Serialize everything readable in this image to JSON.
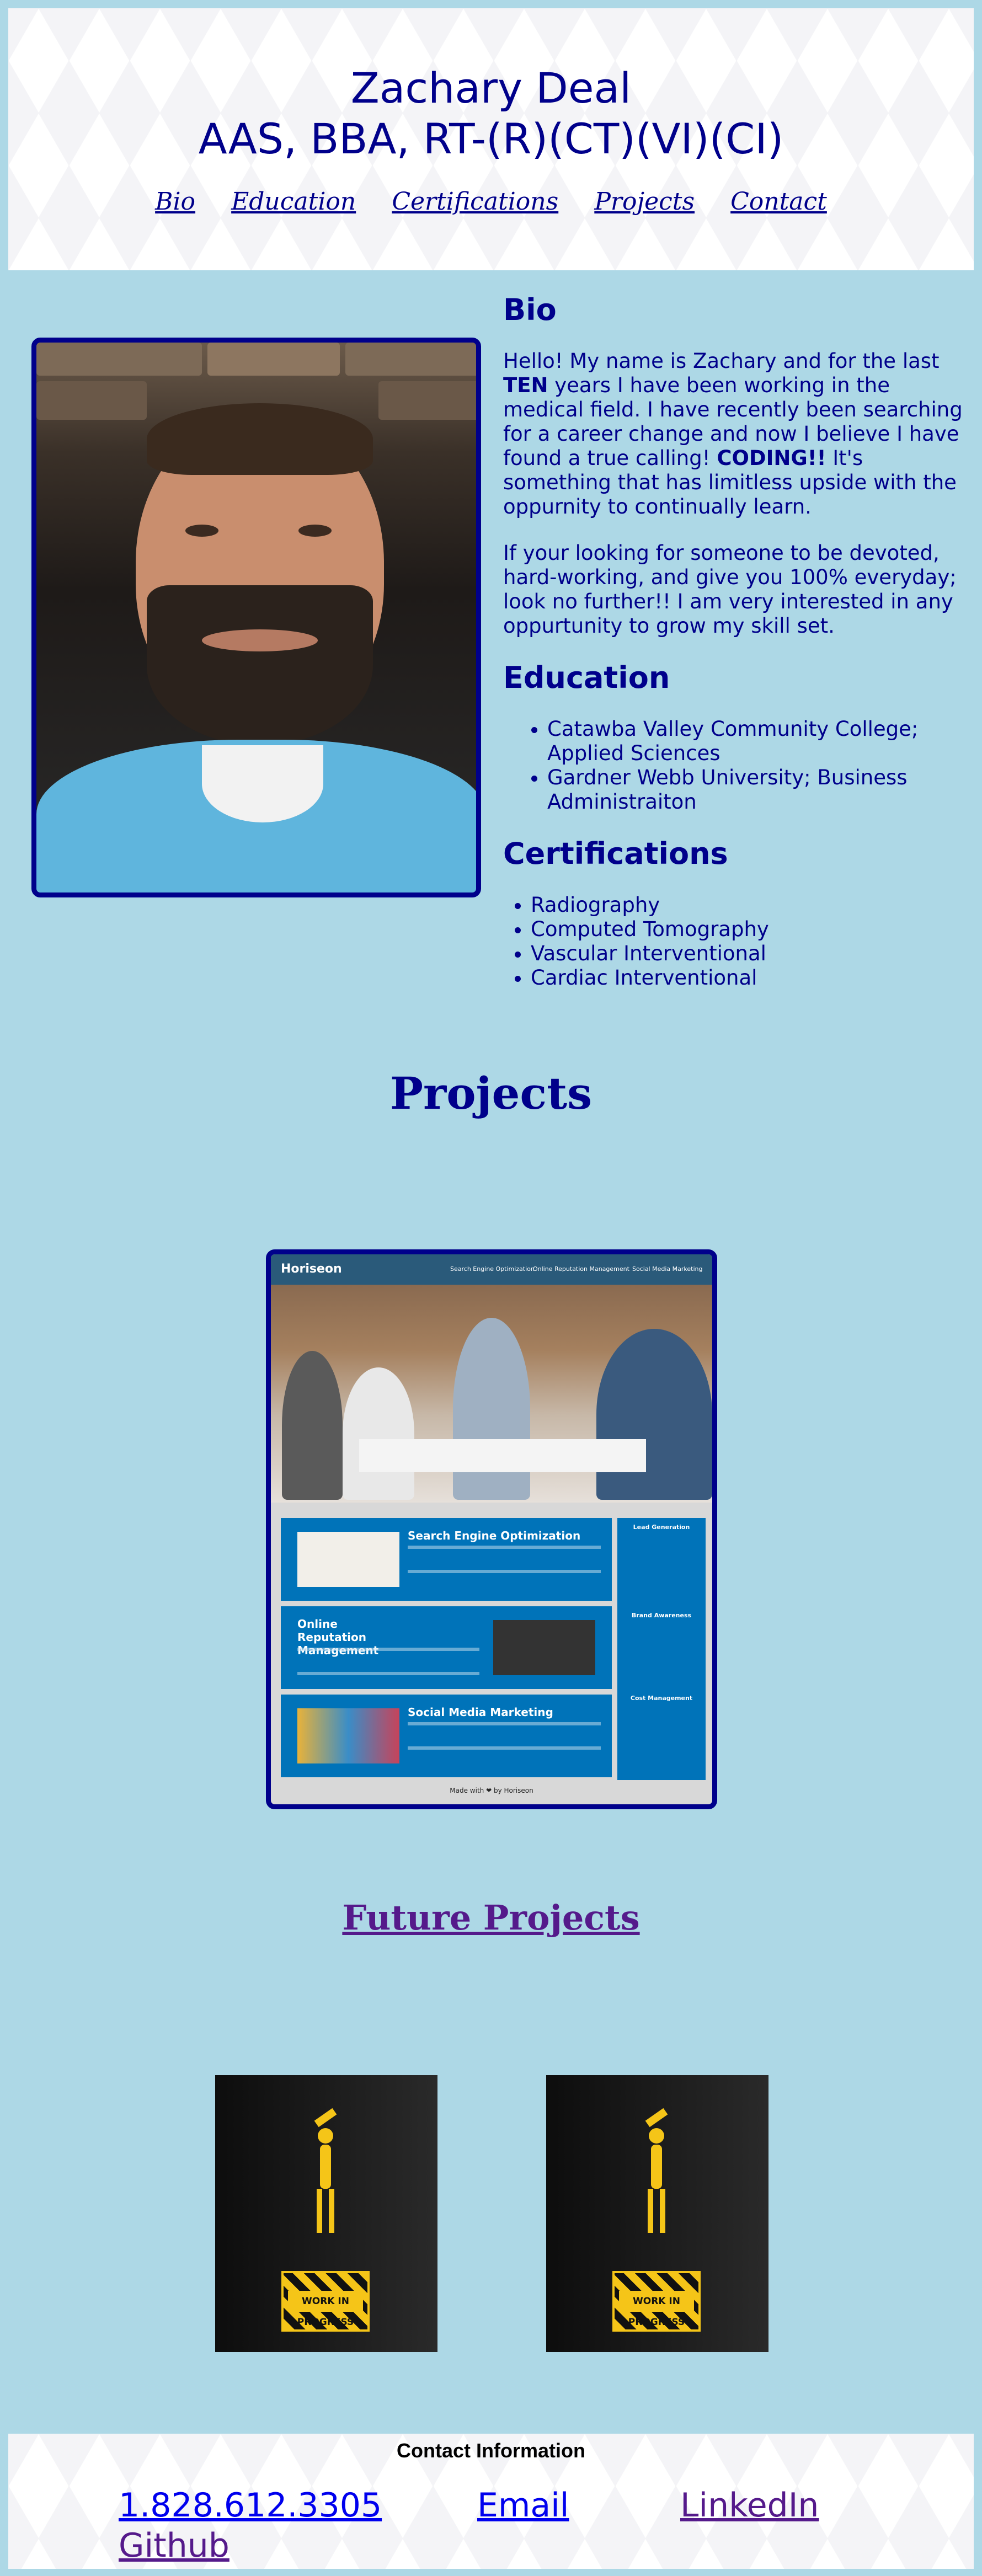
{
  "header": {
    "name": "Zachary Deal",
    "credentials": "AAS, BBA, RT-(R)(CT)(VI)(CI)",
    "nav": [
      "Bio",
      "Education",
      "Certifications",
      "Projects",
      "Contact"
    ]
  },
  "bio": {
    "heading": "Bio",
    "p1_a": "Hello! My name is Zachary and for the last ",
    "p1_ten": "TEN",
    "p1_b": " years I have been working in the medical field. I have recently been searching for a career change and now I believe I have found a true calling! ",
    "p1_coding": "CODING!!",
    "p1_c": " It's something that has limitless upside with the oppurnity to continually learn.",
    "p2": "If your looking for someone to be devoted, hard-working, and give you 100% everyday; look no further!! I am very interested in any oppurtunity to grow my skill set."
  },
  "education": {
    "heading": "Education",
    "items": [
      "Catawba Valley Community College; Applied Sciences",
      "Gardner Webb University; Business Administraiton"
    ]
  },
  "certifications": {
    "heading": "Certifications",
    "items": [
      "Radiography",
      "Computed Tomography",
      "Vascular Interventional",
      "Cardiac Interventional"
    ]
  },
  "projects": {
    "heading": "Projects",
    "horiseon": {
      "logo": "Horiseon",
      "nav": [
        "Search Engine Optimization",
        "Online Reputation Management",
        "Social Media Marketing"
      ],
      "boxes": [
        "Search Engine Optimization",
        "Online Reputation Management",
        "Social Media Marketing"
      ],
      "side": [
        "Lead Generation",
        "Brand Awareness",
        "Cost Management"
      ],
      "footer": "Made with ❤ by Horiseon"
    }
  },
  "future_projects": {
    "heading": "Future Projects",
    "sign_text": "WORK IN PROGRESS"
  },
  "contact": {
    "heading": "Contact Information",
    "phone": "1.828.612.3305",
    "email": "Email",
    "linkedin": "LinkedIn",
    "github": "Github"
  }
}
